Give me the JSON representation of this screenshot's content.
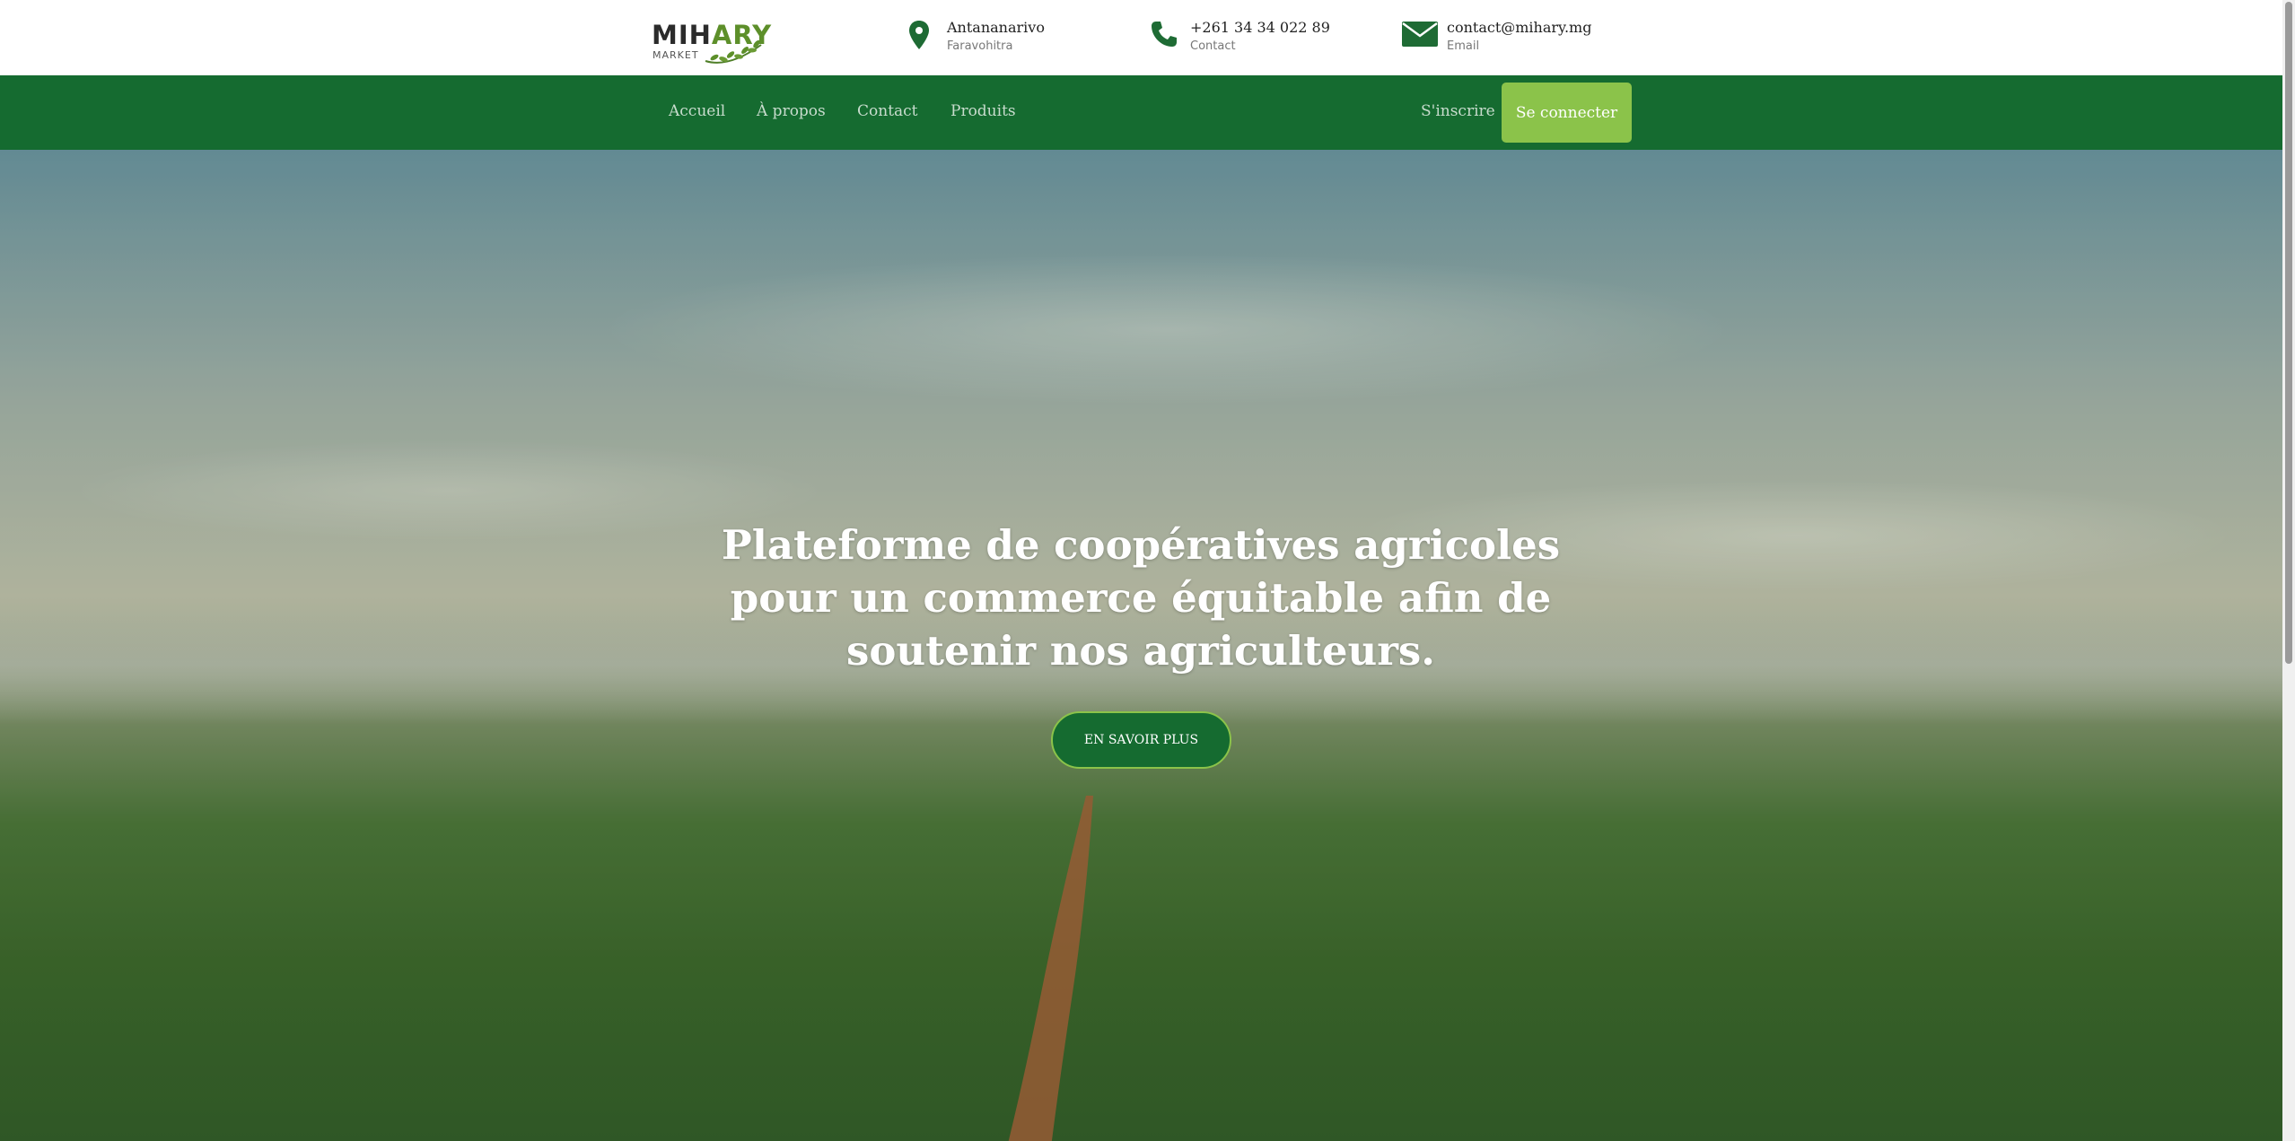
{
  "brand": {
    "logo_main_dark": "MIH",
    "logo_main_green": "ARY",
    "logo_sub": "MARKET"
  },
  "topbar": {
    "location": {
      "icon": "map-pin-icon",
      "line1": "Antananarivo",
      "line2": "Faravohitra"
    },
    "phone": {
      "icon": "phone-icon",
      "line1": "+261 34 34 022 89",
      "line2": "Contact"
    },
    "email": {
      "icon": "envelope-icon",
      "line1": "contact@mihary.mg",
      "line2": "Email"
    }
  },
  "nav": {
    "links": [
      "Accueil",
      "À propos",
      "Contact",
      "Produits"
    ],
    "signup_label": "S'inscrire",
    "login_label": "Se connecter"
  },
  "hero": {
    "title": "Plateforme de coopératives agricoles pour un commerce équitable afin de soutenir nos agriculteurs.",
    "cta_label": "EN SAVOIR PLUS"
  },
  "colors": {
    "primary_green": "#156b30",
    "accent_green": "#8bc34a",
    "icon_green": "#1e6b34"
  }
}
